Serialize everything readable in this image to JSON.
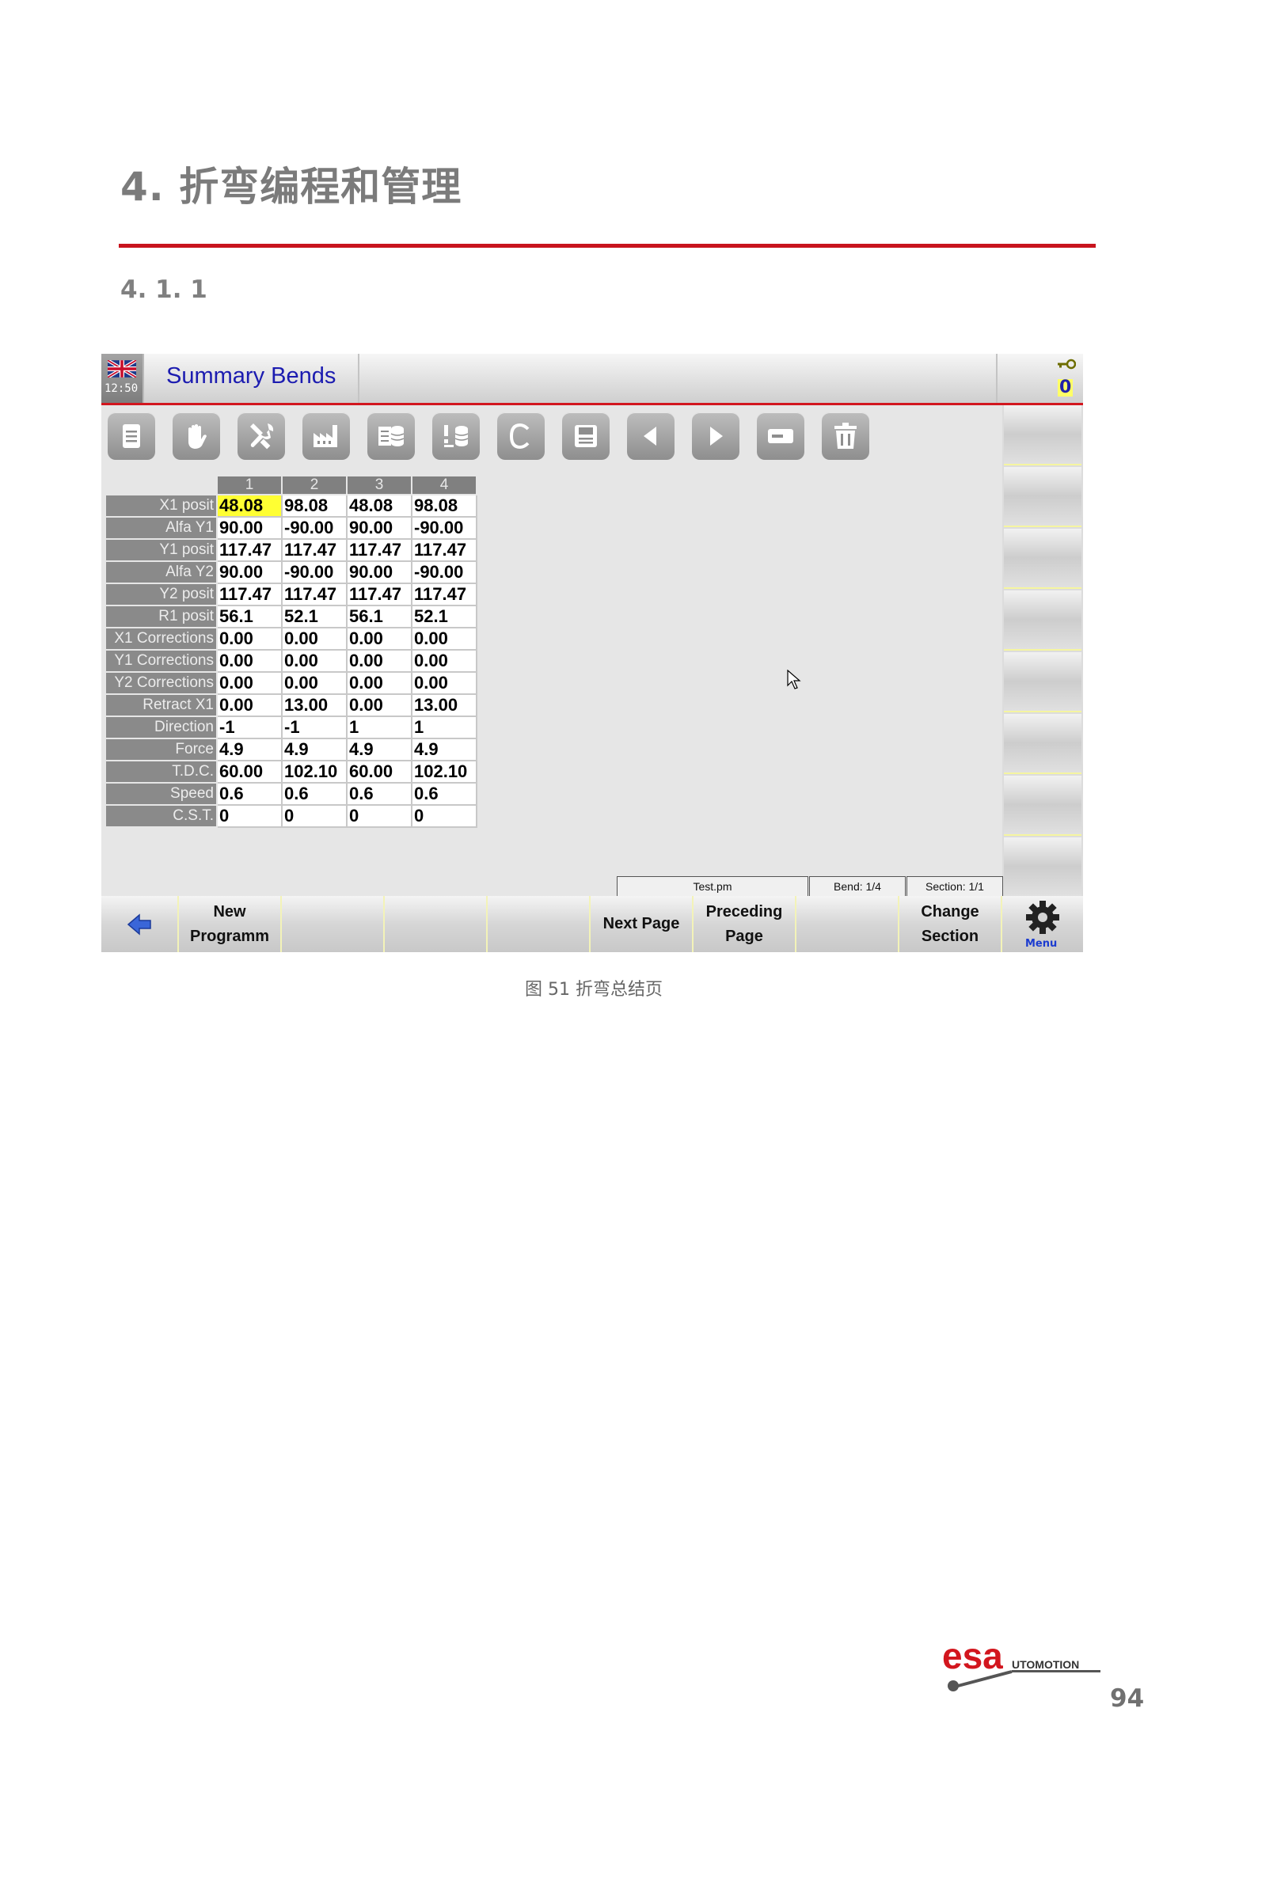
{
  "document": {
    "chapter_number": "4.",
    "chapter_title": "折弯编程和管理",
    "subsection": "4. 1. 1",
    "caption": "图 51  折弯总结页",
    "page_number": "94",
    "logo_text": "esa",
    "logo_subtext": "UTOMOTION"
  },
  "screen": {
    "clock": "12:50",
    "title": "Summary Bends",
    "counter": "0",
    "flag_icon": "uk-flag-icon",
    "key_icon": "key-icon"
  },
  "toolbar": [
    {
      "name": "program-icon"
    },
    {
      "name": "hand-icon"
    },
    {
      "name": "wrench-icon"
    },
    {
      "name": "factory-icon"
    },
    {
      "name": "database-list-icon"
    },
    {
      "name": "database-edit-icon"
    },
    {
      "name": "c-icon"
    },
    {
      "name": "save-icon"
    },
    {
      "name": "arrow-left-icon"
    },
    {
      "name": "arrow-right-icon"
    },
    {
      "name": "card-icon"
    },
    {
      "name": "trash-icon"
    }
  ],
  "table": {
    "columns": [
      "1",
      "2",
      "3",
      "4"
    ],
    "rows": [
      {
        "label": "X1 posit",
        "values": [
          "48.08",
          "98.08",
          "48.08",
          "98.08"
        ]
      },
      {
        "label": "Alfa Y1",
        "values": [
          "90.00",
          "-90.00",
          "90.00",
          "-90.00"
        ]
      },
      {
        "label": "Y1 posit",
        "values": [
          "117.47",
          "117.47",
          "117.47",
          "117.47"
        ]
      },
      {
        "label": "Alfa Y2",
        "values": [
          "90.00",
          "-90.00",
          "90.00",
          "-90.00"
        ]
      },
      {
        "label": "Y2 posit",
        "values": [
          "117.47",
          "117.47",
          "117.47",
          "117.47"
        ]
      },
      {
        "label": "R1 posit",
        "values": [
          "56.1",
          "52.1",
          "56.1",
          "52.1"
        ]
      },
      {
        "label": "X1 Corrections",
        "values": [
          "0.00",
          "0.00",
          "0.00",
          "0.00"
        ]
      },
      {
        "label": "Y1 Corrections",
        "values": [
          "0.00",
          "0.00",
          "0.00",
          "0.00"
        ]
      },
      {
        "label": "Y2 Corrections",
        "values": [
          "0.00",
          "0.00",
          "0.00",
          "0.00"
        ]
      },
      {
        "label": "Retract X1",
        "values": [
          "0.00",
          "13.00",
          "0.00",
          "13.00"
        ]
      },
      {
        "label": "Direction",
        "values": [
          "-1",
          "-1",
          "1",
          "1"
        ]
      },
      {
        "label": "Force",
        "values": [
          "4.9",
          "4.9",
          "4.9",
          "4.9"
        ]
      },
      {
        "label": "T.D.C.",
        "values": [
          "60.00",
          "102.10",
          "60.00",
          "102.10"
        ]
      },
      {
        "label": "Speed",
        "values": [
          "0.6",
          "0.6",
          "0.6",
          "0.6"
        ]
      },
      {
        "label": "C.S.T.",
        "values": [
          "0",
          "0",
          "0",
          "0"
        ]
      }
    ],
    "selected_color": "#ffff33"
  },
  "status": {
    "file": "Test.pm",
    "bend": "Bend: 1/4",
    "section": "Section: 1/1"
  },
  "bottom": {
    "new_program_1": "New",
    "new_program_2": "Programm",
    "next_page": "Next Page",
    "preceding_1": "Preceding",
    "preceding_2": "Page",
    "change_1": "Change",
    "change_2": "Section",
    "menu": "Menu"
  },
  "colors": {
    "accent_red": "#c8141e",
    "title_blue": "#1c1cb0"
  }
}
